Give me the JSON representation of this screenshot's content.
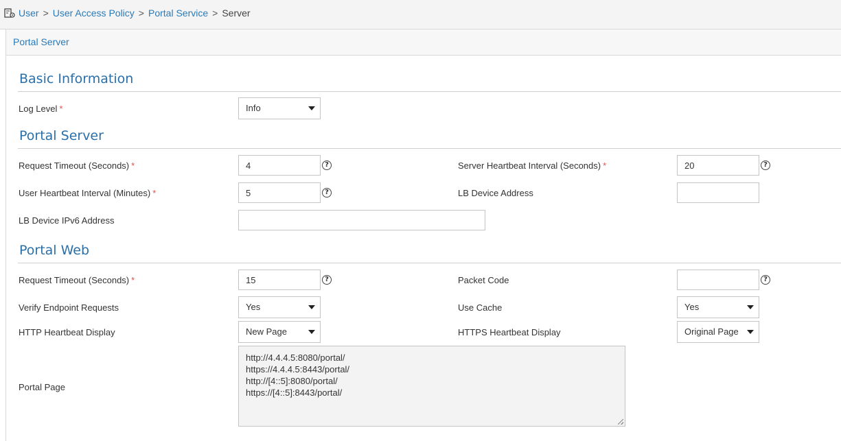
{
  "breadcrumb": {
    "icon": "user-settings-icon",
    "items": [
      "User",
      "User Access Policy",
      "Portal Service"
    ],
    "separator": ">",
    "current": "Server"
  },
  "panel": {
    "title": "Portal Server"
  },
  "sections": {
    "basic": "Basic Information",
    "portal_server": "Portal Server",
    "portal_web": "Portal Web"
  },
  "fields": {
    "log_level": {
      "label": "Log Level",
      "required": "*",
      "value": "Info"
    },
    "ps_request_timeout": {
      "label": "Request Timeout (Seconds)",
      "required": "*",
      "value": "4"
    },
    "server_heartbeat": {
      "label": "Server Heartbeat Interval (Seconds)",
      "required": "*",
      "value": "20"
    },
    "user_heartbeat": {
      "label": "User Heartbeat Interval (Minutes)",
      "required": "*",
      "value": "5"
    },
    "lb_device_address": {
      "label": "LB Device Address",
      "value": ""
    },
    "lb_device_ipv6": {
      "label": "LB Device IPv6 Address",
      "value": ""
    },
    "pw_request_timeout": {
      "label": "Request Timeout (Seconds)",
      "required": "*",
      "value": "15"
    },
    "packet_code": {
      "label": "Packet Code",
      "value": ""
    },
    "verify_endpoint": {
      "label": "Verify Endpoint Requests",
      "value": "Yes"
    },
    "use_cache": {
      "label": "Use Cache",
      "value": "Yes"
    },
    "http_heartbeat": {
      "label": "HTTP Heartbeat Display",
      "value": "New Page"
    },
    "https_heartbeat": {
      "label": "HTTPS Heartbeat Display",
      "value": "Original Page"
    },
    "portal_page": {
      "label": "Portal Page",
      "lines": [
        "http://4.4.4.5:8080/portal/",
        "https://4.4.4.5:8443/portal/",
        "http://[4::5]:8080/portal/",
        "https://[4::5]:8443/portal/"
      ]
    }
  },
  "help_glyph": "?",
  "colors": {
    "link": "#2a7ab8",
    "section": "#2a6fa8",
    "required": "#d9534f"
  }
}
